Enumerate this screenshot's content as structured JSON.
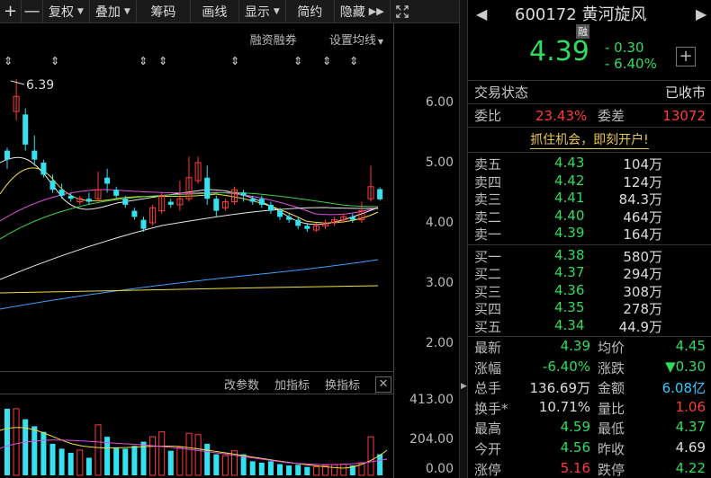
{
  "toolbar": {
    "plus": "+",
    "minus": "—",
    "fuquan": "复权",
    "diejia": "叠加",
    "chouma": "筹码",
    "huaxian": "画线",
    "xianshi": "显示",
    "jianyue": "简约",
    "yincang": "隐藏"
  },
  "chart_top": {
    "rongzi": "融资融券",
    "shezhi": "设置均线"
  },
  "price_axis": [
    "6.00",
    "5.00",
    "4.00",
    "3.00",
    "2.00"
  ],
  "volume_axis": [
    "413.00",
    "204.00",
    "0.00"
  ],
  "high_marker": "6.39",
  "indicator_bar": {
    "gaicanshu": "改参数",
    "jiazhibiao": "加指标",
    "huanzhibiao": "换指标"
  },
  "stock": {
    "code": "600172",
    "name": "黄河旋风",
    "rong": "融",
    "price": "4.39",
    "change": "- 0.30",
    "change_pct": "- 6.40%"
  },
  "status": {
    "label": "交易状态",
    "value": "已收市"
  },
  "weibi": {
    "label1": "委比",
    "value1": "23.43%",
    "label2": "委差",
    "value2": "13072"
  },
  "promo": "抓住机会，即刻开户!",
  "order_book": {
    "asks": [
      {
        "label": "卖五",
        "price": "4.43",
        "vol": "104万"
      },
      {
        "label": "卖四",
        "price": "4.42",
        "vol": "124万"
      },
      {
        "label": "卖三",
        "price": "4.41",
        "vol": "84.3万"
      },
      {
        "label": "卖二",
        "price": "4.40",
        "vol": "464万"
      },
      {
        "label": "卖一",
        "price": "4.39",
        "vol": "164万"
      }
    ],
    "bids": [
      {
        "label": "买一",
        "price": "4.38",
        "vol": "580万"
      },
      {
        "label": "买二",
        "price": "4.37",
        "vol": "294万"
      },
      {
        "label": "买三",
        "price": "4.36",
        "vol": "308万"
      },
      {
        "label": "买四",
        "price": "4.35",
        "vol": "278万"
      },
      {
        "label": "买五",
        "price": "4.34",
        "vol": "44.9万"
      }
    ]
  },
  "stats": [
    {
      "k1": "最新",
      "v1": "4.39",
      "c1": "green",
      "k2": "均价",
      "v2": "4.45",
      "c2": "green"
    },
    {
      "k1": "涨幅",
      "v1": "-6.40%",
      "c1": "green",
      "k2": "涨跌",
      "v2": "▼0.30",
      "c2": "green"
    },
    {
      "k1": "总手",
      "v1": "136.69万",
      "c1": "white",
      "k2": "金额",
      "v2": "6.08亿",
      "c2": "cyan"
    },
    {
      "k1": "换手*",
      "v1": "10.71%",
      "c1": "white",
      "k2": "量比",
      "v2": "1.06",
      "c2": "red"
    },
    {
      "k1": "最高",
      "v1": "4.59",
      "c1": "green",
      "k2": "最低",
      "v2": "4.37",
      "c2": "green"
    },
    {
      "k1": "今开",
      "v1": "4.56",
      "c1": "green",
      "k2": "昨收",
      "v2": "4.69",
      "c2": "white"
    },
    {
      "k1": "涨停",
      "v1": "5.16",
      "c1": "red",
      "k2": "跌停",
      "v2": "4.22",
      "c2": "green"
    }
  ],
  "colors": {
    "up": "#ff3b3b",
    "down": "#2fdc5e",
    "down_candle": "#35e0f0",
    "promo": "#e8c84c"
  }
}
